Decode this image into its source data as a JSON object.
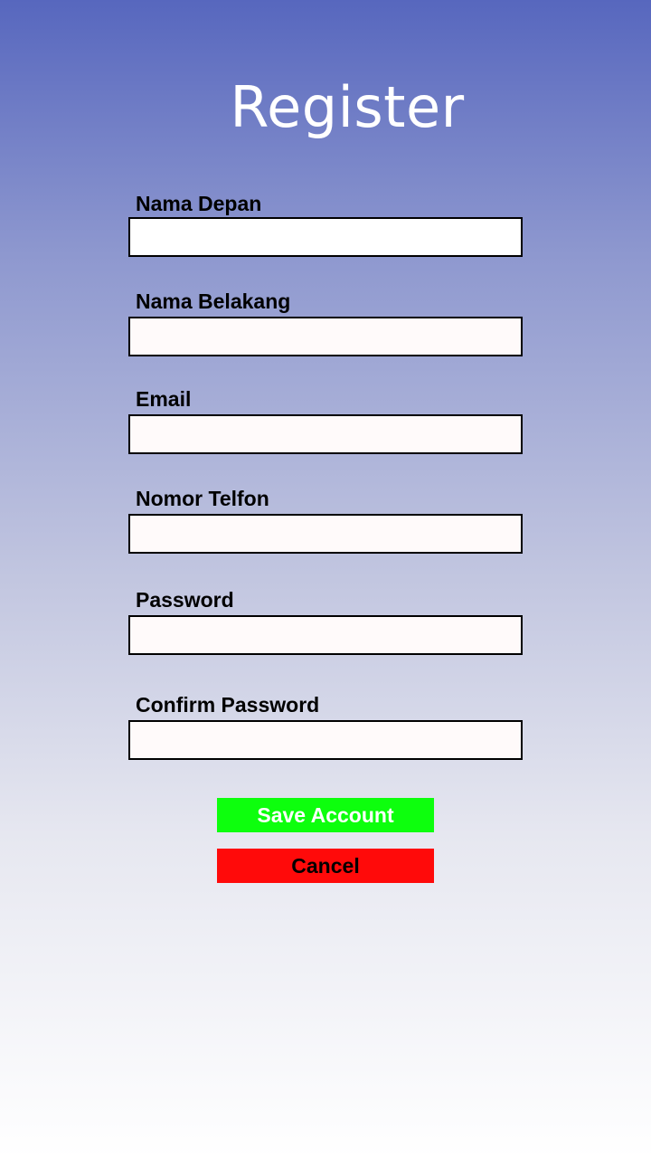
{
  "page": {
    "title": "Register"
  },
  "form": {
    "fields": [
      {
        "label": "Nama Depan",
        "value": "",
        "placeholder": ""
      },
      {
        "label": "Nama Belakang",
        "value": "",
        "placeholder": ""
      },
      {
        "label": "Email",
        "value": "",
        "placeholder": ""
      },
      {
        "label": "Nomor Telfon",
        "value": "",
        "placeholder": ""
      },
      {
        "label": "Password",
        "value": "",
        "placeholder": ""
      },
      {
        "label": "Confirm Password",
        "value": "",
        "placeholder": ""
      }
    ],
    "save_label": "Save Account",
    "cancel_label": "Cancel"
  },
  "colors": {
    "gradient_top": "#5767be",
    "gradient_bottom": "#ffffff",
    "save_button": "#0dff0d",
    "cancel_button": "#ff0a0a"
  }
}
